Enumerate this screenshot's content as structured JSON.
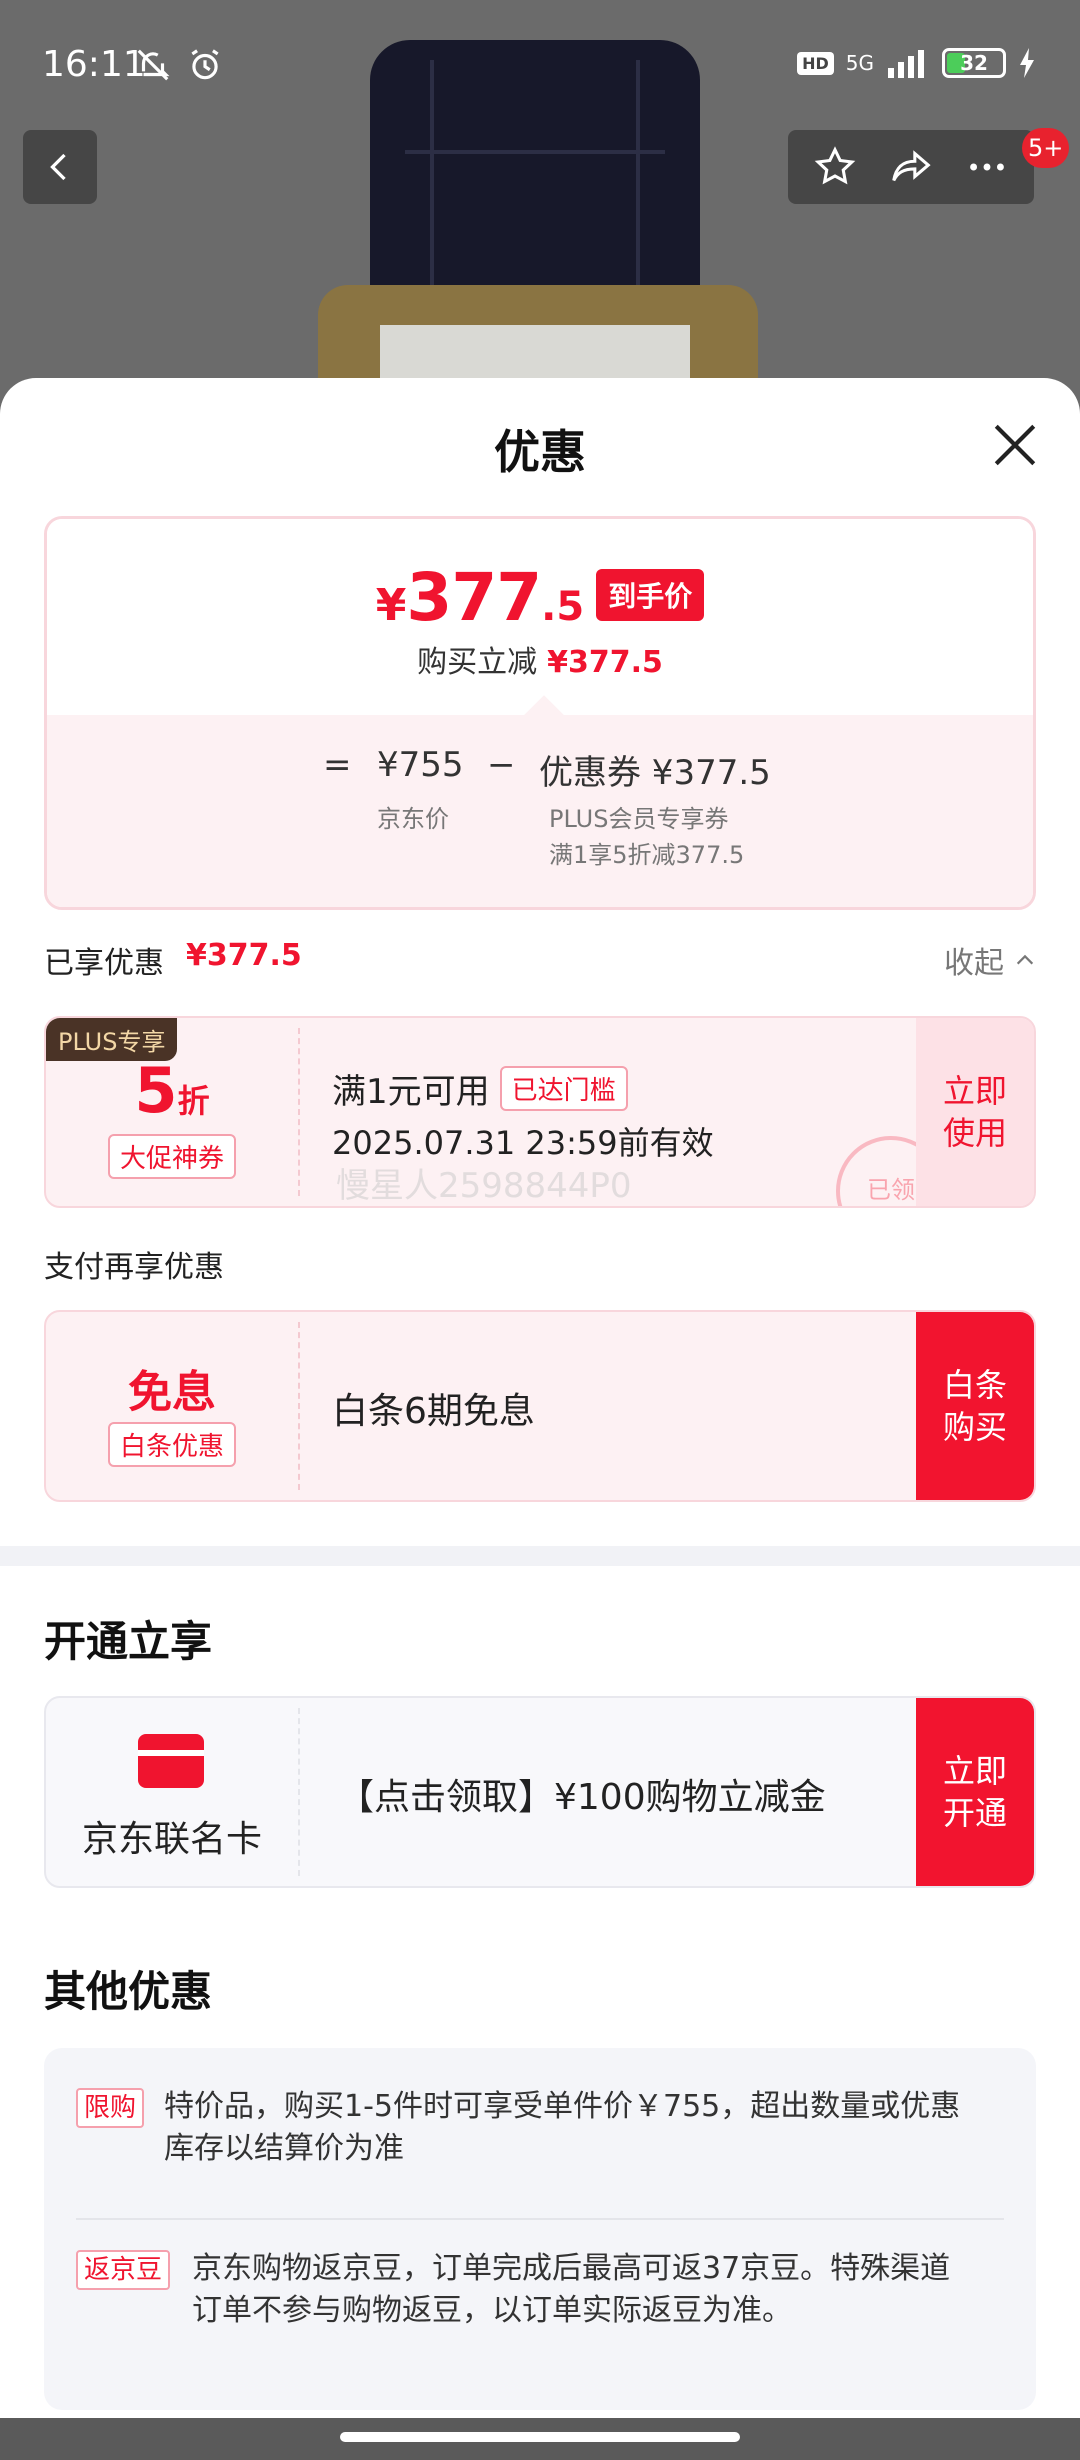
{
  "status": {
    "time": "16:11",
    "hd": "HD",
    "network": "5G",
    "battery": "32"
  },
  "nav": {
    "badge": "5+"
  },
  "sheet": {
    "title": "优惠"
  },
  "price": {
    "currency": "¥",
    "integer": "377",
    "decimal": ".5",
    "tag": "到手价",
    "reduce_label": "购买立减",
    "reduce_value": "¥377.5",
    "equals": "=",
    "jd_price": "¥755",
    "minus": "−",
    "coupon_label": "优惠券 ¥377.5",
    "jd_price_label": "京东价",
    "coupon_sub1": "PLUS会员专享券",
    "coupon_sub2": "满1享5折减377.5"
  },
  "enjoyed": {
    "label": "已享优惠",
    "value": "¥377.5",
    "collapse": "收起"
  },
  "coupon": {
    "plus_tag": "PLUS专享",
    "discount_num": "5",
    "discount_unit": "折",
    "type": "大促神券",
    "condition": "满1元可用",
    "status": "已达门槛",
    "expiry": "2025.07.31 23:59前有效",
    "watermark": "慢星人2598844P0",
    "stamp": "已领",
    "use_btn_line1": "立即",
    "use_btn_line2": "使用"
  },
  "pay": {
    "section": "支付再享优惠",
    "title": "免息",
    "tag": "白条优惠",
    "text": "白条6期免息",
    "btn_line1": "白条",
    "btn_line2": "购买"
  },
  "open": {
    "section": "开通立享",
    "card_name": "京东联名卡",
    "text": "【点击领取】¥100购物立减金",
    "btn_line1": "立即",
    "btn_line2": "开通"
  },
  "other": {
    "section": "其他优惠",
    "items": [
      {
        "tag": "限购",
        "text": "特价品，购买1-5件时可享受单件价￥755，超出数量或优惠库存以结算价为准"
      },
      {
        "tag": "返京豆",
        "text": "京东购物返京豆，订单完成后最高可返37京豆。特殊渠道订单不参与购物返豆，以订单实际返豆为准。"
      }
    ]
  },
  "colors": {
    "accent": "#f0142f",
    "card_bg": "#fdf1f3",
    "plus_bg": "#4a3326"
  }
}
